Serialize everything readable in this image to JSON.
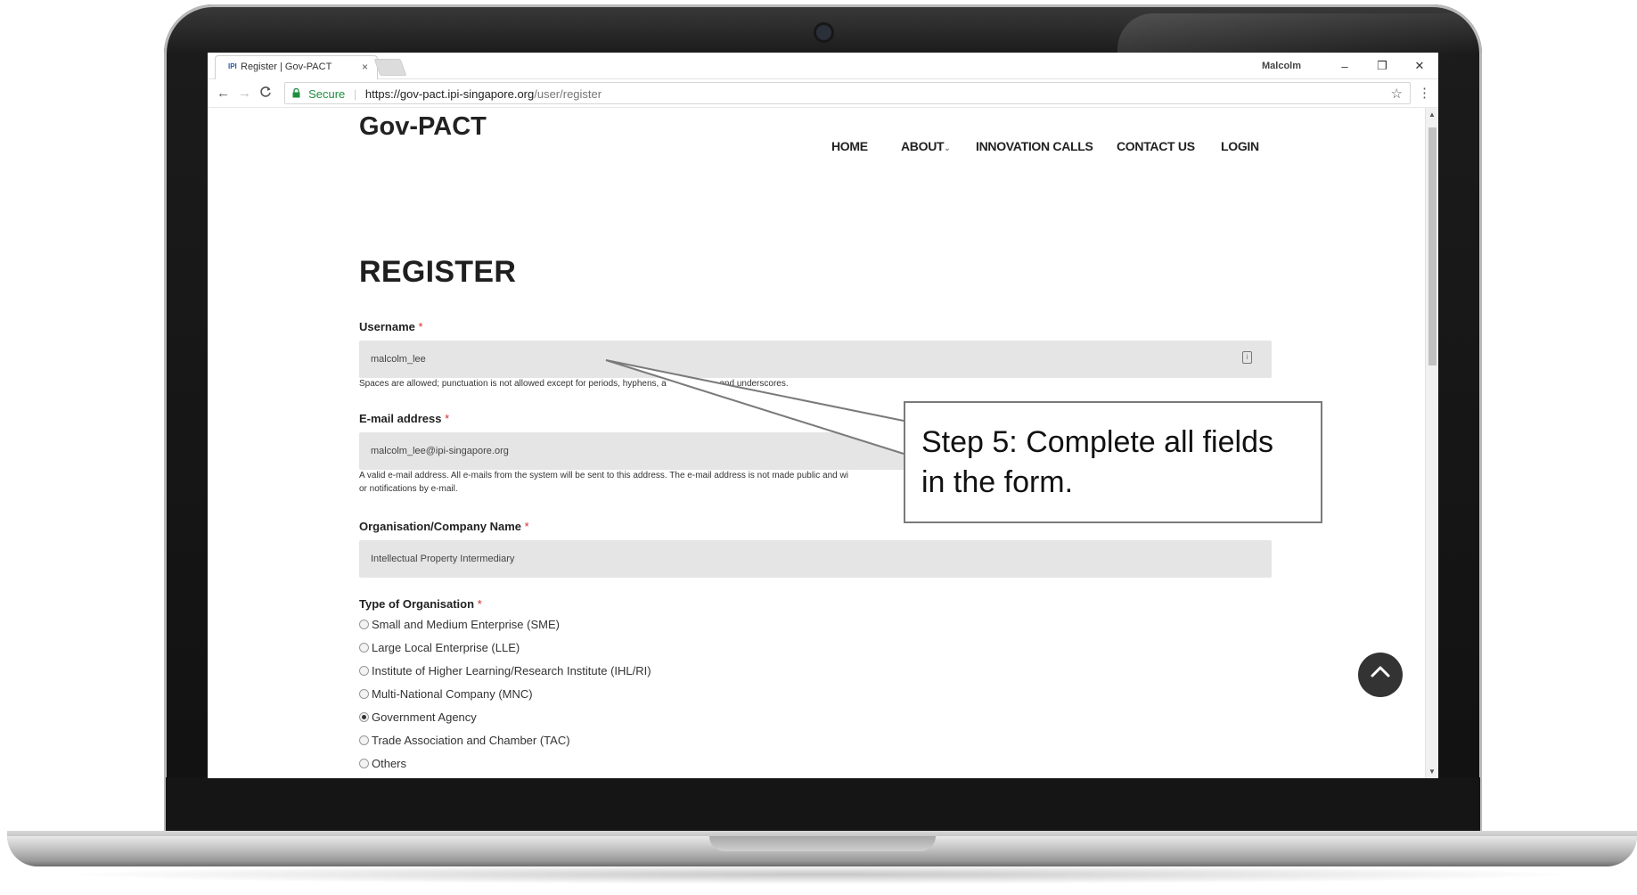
{
  "browser": {
    "tab_title": "Register | Gov-PACT",
    "tab_favicon": "IPI",
    "tab_close": "×",
    "user": "Malcolm",
    "win_minimize": "–",
    "win_restore": "❐",
    "win_close": "✕",
    "back": "←",
    "forward": "→",
    "reload": "C",
    "secure_label": "Secure",
    "url_host": "https://gov-pact.ipi-singapore.org",
    "url_path": "/user/register",
    "star": "☆",
    "menu": "⋮"
  },
  "site": {
    "logo": "Gov-PACT",
    "nav": {
      "home": "HOME",
      "about": "ABOUT",
      "innovation": "INNOVATION CALLS",
      "contact": "CONTACT US",
      "login": "LOGIN"
    }
  },
  "form": {
    "title": "REGISTER",
    "required_mark": "*",
    "username": {
      "label": "Username",
      "value": "malcolm_lee",
      "help": "Spaces are allowed; punctuation is not allowed except for periods, hyphens, a",
      "help_tail": "hes, and underscores."
    },
    "email": {
      "label": "E-mail address",
      "value": "malcolm_lee@ipi-singapore.org",
      "help_line1": "A valid e-mail address. All e-mails from the system will be sent to this address. The e-mail address is not made public and wi",
      "help_line2": "or notifications by e-mail."
    },
    "organisation": {
      "label": "Organisation/Company Name",
      "value": "Intellectual Property Intermediary"
    },
    "org_type": {
      "label": "Type of Organisation",
      "options": [
        "Small and Medium Enterprise (SME)",
        "Large Local Enterprise (LLE)",
        "Institute of Higher Learning/Research Institute (IHL/RI)",
        "Multi-National Company (MNC)",
        "Government Agency",
        "Trade Association and Chamber (TAC)",
        "Others"
      ],
      "selected": "Government Agency"
    }
  },
  "callout": {
    "text_line1": "Step 5: Complete all fields",
    "text_line2": "in the form."
  },
  "icons": {
    "back_to_top": "chevron-up-icon",
    "lock": "lock-icon",
    "field": "id-card-icon"
  }
}
